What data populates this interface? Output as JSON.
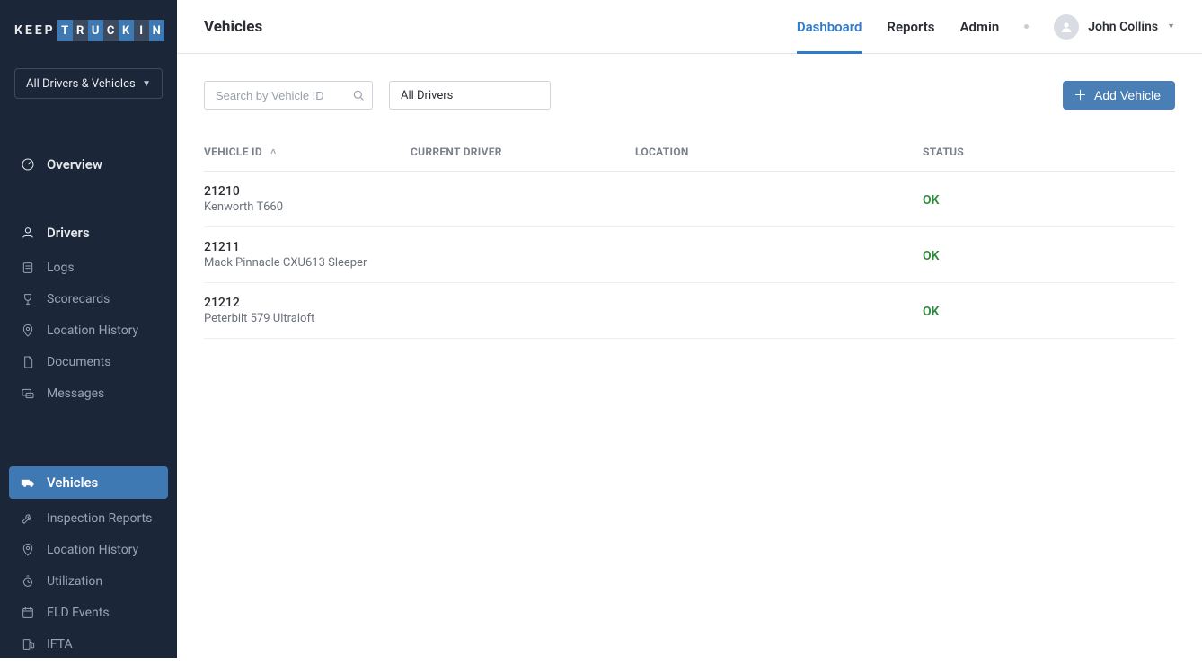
{
  "brand": {
    "text_keep": "KEEP",
    "text_truckin": [
      "T",
      "R",
      "U",
      "C",
      "K",
      "I",
      "N"
    ]
  },
  "sidebar": {
    "scope_label": "All Drivers & Vehicles",
    "overview": "Overview",
    "group1": {
      "header": "Drivers",
      "items": [
        "Logs",
        "Scorecards",
        "Location History",
        "Documents",
        "Messages"
      ]
    },
    "group2": {
      "header": "Vehicles",
      "items": [
        "Inspection Reports",
        "Location History",
        "Utilization",
        "ELD Events",
        "IFTA"
      ]
    }
  },
  "header": {
    "page_title": "Vehicles",
    "nav": {
      "dashboard": "Dashboard",
      "reports": "Reports",
      "admin": "Admin"
    },
    "user_name": "John Collins"
  },
  "toolbar": {
    "search_placeholder": "Search by Vehicle ID",
    "driver_filter": "All Drivers",
    "add_button": "Add Vehicle"
  },
  "table": {
    "columns": {
      "vehicle_id": "VEHICLE ID",
      "current_driver": "CURRENT DRIVER",
      "location": "LOCATION",
      "status": "STATUS"
    },
    "rows": [
      {
        "id": "21210",
        "model": "Kenworth T660",
        "driver": "",
        "location": "",
        "status": "OK"
      },
      {
        "id": "21211",
        "model": "Mack Pinnacle CXU613 Sleeper",
        "driver": "",
        "location": "",
        "status": "OK"
      },
      {
        "id": "21212",
        "model": "Peterbilt 579 Ultraloft",
        "driver": "",
        "location": "",
        "status": "OK"
      }
    ]
  },
  "colors": {
    "sidebar_bg": "#1b2638",
    "accent": "#3e79b4",
    "add_btn": "#4a7fb6",
    "link_active": "#2f7ac9",
    "status_ok": "#2e8b3d"
  }
}
